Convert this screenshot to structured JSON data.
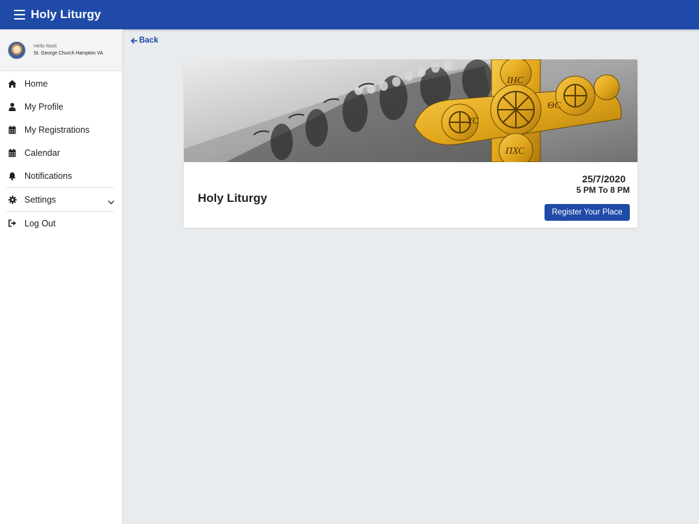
{
  "header": {
    "title": "Holy Liturgy",
    "menu_icon": "hamburger-icon",
    "bar_color": "#1f4aa8"
  },
  "user": {
    "greeting": "Hello Mark",
    "church": "St. George Church Hampton VA"
  },
  "sidebar": {
    "items": [
      {
        "label": "Home",
        "icon": "home-icon"
      },
      {
        "label": "My Profile",
        "icon": "user-icon"
      },
      {
        "label": "My Registrations",
        "icon": "calendar-icon"
      },
      {
        "label": "Calendar",
        "icon": "calendar-icon"
      },
      {
        "label": "Notifications",
        "icon": "bell-icon"
      },
      {
        "label": "Settings",
        "icon": "gear-icon"
      },
      {
        "label": "Log Out",
        "icon": "logout-icon"
      }
    ]
  },
  "back": {
    "label": "Back"
  },
  "event": {
    "title": "Holy Liturgy",
    "date": "25/7/2020",
    "time": "5 PM To 8 PM",
    "register_label": "Register Your Place",
    "banner_text": {
      "top": "ІНС",
      "left": "ΥС",
      "right": "ΘС",
      "bottom": "ПХС"
    }
  },
  "colors": {
    "accent": "#1f4aa8",
    "background": "#e9ecee"
  }
}
